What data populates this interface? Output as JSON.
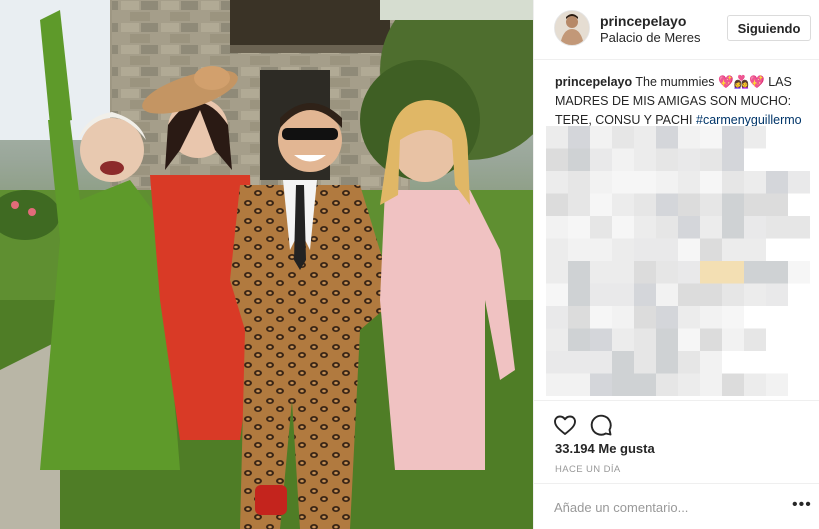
{
  "post": {
    "username": "princepelayo",
    "location": "Palacio de Meres",
    "follow_label": "Siguiendo",
    "caption": {
      "user": "princepelayo",
      "text": " The mummies 💖👩‍❤️‍👩💖 LAS MADRES DE MIS AMIGAS SON MUCHO: TERE, CONSU Y PACHI ",
      "hashtag": "#carmenyguillermo"
    },
    "likes": "33.194 Me gusta",
    "date": "HACE UN DÍA",
    "comment_placeholder": "Añade un comentario...",
    "more_label": "•••"
  },
  "icons": {
    "like": "heart-icon",
    "comment": "comment-bubble-icon",
    "more": "more-options-icon"
  },
  "colors": {
    "hashtag": "#003569",
    "border": "#efefef",
    "text": "#262626",
    "muted": "#999999"
  }
}
